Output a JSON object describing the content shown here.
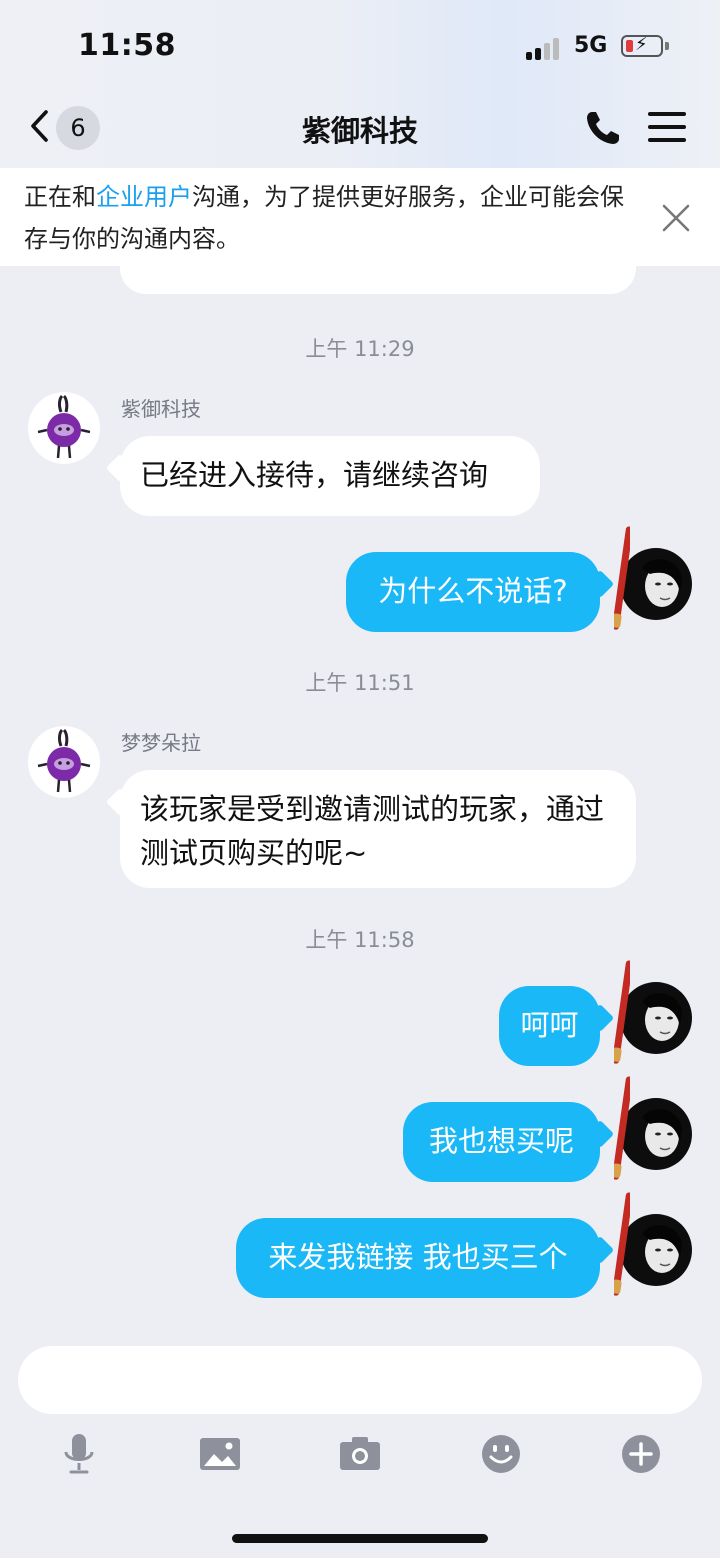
{
  "status_bar": {
    "time": "11:58",
    "network": "5G"
  },
  "header": {
    "back_count": "6",
    "title": "紫御科技"
  },
  "notice": {
    "text_before": "正在和",
    "highlight": "企业用户",
    "text_after": "沟通，为了提供更好服务，企业可能会保存与你的沟通内容。"
  },
  "messages": {
    "ts1": "上午 11:29",
    "m1_sender": "紫御科技",
    "m1_text": "已经进入接待，请继续咨询",
    "m2_text": "为什么不说话?",
    "ts2": "上午 11:51",
    "m3_sender": "梦梦朵拉",
    "m3_text": "该玩家是受到邀请测试的玩家，通过测试页购买的呢~",
    "ts3": "上午 11:58",
    "m4_text": "呵呵",
    "m5_text": "我也想买呢",
    "m6_text": "来发我链接 我也买三个"
  },
  "input": {
    "value": ""
  },
  "toolbar": {
    "icons": [
      "microphone-icon",
      "image-icon",
      "camera-icon",
      "emoji-icon",
      "plus-icon"
    ]
  },
  "colors": {
    "accent": "#1ab8f7",
    "link": "#1aa0ee",
    "background": "#eceef4"
  }
}
